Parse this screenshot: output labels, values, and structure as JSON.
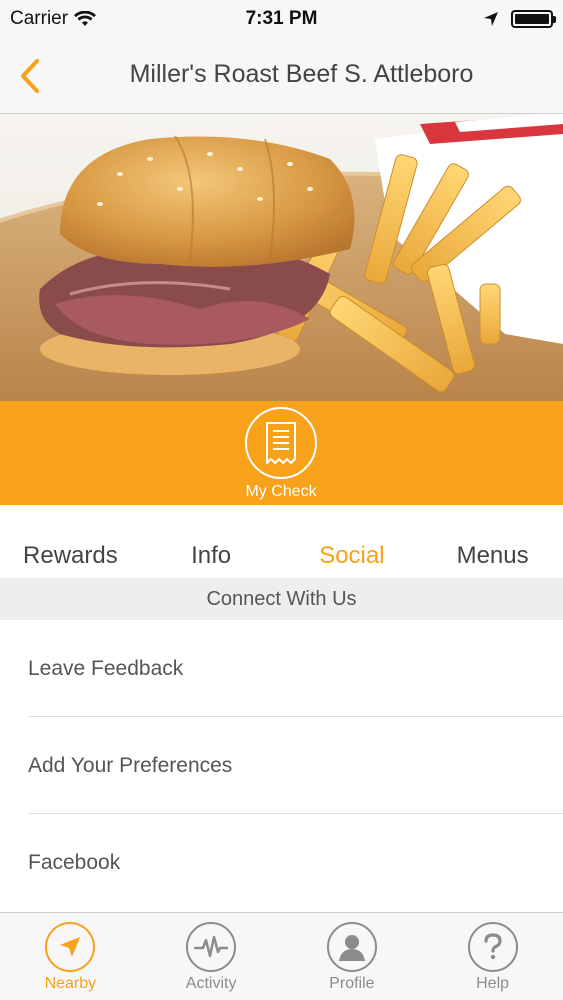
{
  "status_bar": {
    "carrier": "Carrier",
    "time": "7:31 PM"
  },
  "nav": {
    "title": "Miller's Roast Beef S. Attleboro",
    "back_icon": "chevron-left-icon"
  },
  "hero": {
    "description_icon": "roast-beef-sandwich-and-fries-photo"
  },
  "mycheck": {
    "label": "My Check",
    "icon": "receipt-icon"
  },
  "tabs": [
    {
      "label": "Rewards",
      "active": false
    },
    {
      "label": "Info",
      "active": false
    },
    {
      "label": "Social",
      "active": true
    },
    {
      "label": "Menus",
      "active": false
    }
  ],
  "section": {
    "title": "Connect With Us"
  },
  "list": [
    {
      "label": "Leave Feedback"
    },
    {
      "label": "Add Your Preferences"
    },
    {
      "label": "Facebook"
    }
  ],
  "tab_bar": [
    {
      "label": "Nearby",
      "icon": "location-arrow-icon",
      "active": true
    },
    {
      "label": "Activity",
      "icon": "pulse-icon",
      "active": false
    },
    {
      "label": "Profile",
      "icon": "person-icon",
      "active": false
    },
    {
      "label": "Help",
      "icon": "question-icon",
      "active": false
    }
  ],
  "colors": {
    "accent": "#f8a11a",
    "inactive": "#8c8c8c"
  }
}
